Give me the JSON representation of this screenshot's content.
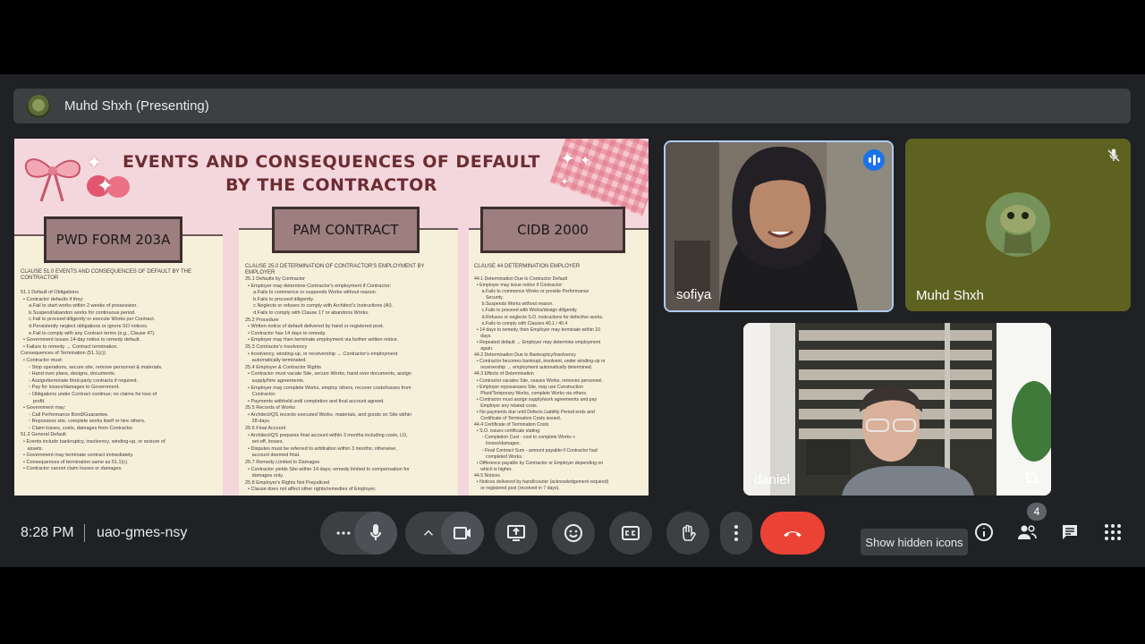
{
  "presenter_bar": {
    "label": "Muhd Shxh (Presenting)"
  },
  "slide": {
    "title_line1": "EVENTS AND CONSEQUENCES OF DEFAULT",
    "title_line2": "BY THE CONTRACTOR",
    "columns": [
      {
        "heading": "PWD FORM 203A",
        "subtitle": "CLAUSE 51.0 EVENTS AND CONSEQUENCES OF DEFAULT BY THE CONTRACTOR",
        "lines": [
          "51.1 Default of Obligations",
          "  • Contractor defaults if they:",
          "      a.Fail to start works within 2 weeks of possession.",
          "      b.Suspend/abandon works for continuous period.",
          "      c.Fail to proceed diligently or execute Works per Contract.",
          "      d.Persistently neglect obligations or ignore SO notices.",
          "      e.Fail to comply with any Contract terms (e.g., Clause 47).",
          "  • Government issues 14-day notice to remedy default.",
          "  • Failure to remedy → Contract termination.",
          "Consequences of Termination (51.1(c))",
          "  • Contractor must:",
          "      ◦ Stop operations, secure site, remove personnel & materials.",
          "      ◦ Hand over plans, designs, documents.",
          "      ◦ Assign/terminate third-party contracts if required.",
          "      ◦ Pay for losses/damages to Government.",
          "      ◦ Obligations under Contract continue; no claims for loss of",
          "         profit.",
          "  • Government may:",
          "      ◦ Call Performance Bond/Guarantee.",
          "      ◦ Repossess site, complete works itself or hire others.",
          "      ◦ Claim losses, costs, damages from Contractor.",
          "51.2 General Default",
          "  • Events include bankruptcy, insolvency, winding-up, or seizure of",
          "     assets.",
          "  • Government may terminate contract immediately.",
          "  • Consequences of termination same as 51.1(c).",
          "  • Contractor cannot claim losses or damages."
        ]
      },
      {
        "heading": "PAM CONTRACT",
        "subtitle": "CLAUSE 25.0 DETERMINATION OF CONTRACTOR'S EMPLOYMENT BY EMPLOYER",
        "lines": [
          "25.1 Defaults by Contractor",
          "  • Employer may determine Contractor's employment if Contractor:",
          "      a.Fails to commence or suspends Works without reason.",
          "      b.Fails to proceed diligently.",
          "      c.Neglects or refuses to comply with Architect's Instructions (AI).",
          "      d.Fails to comply with Clause 17 or abandons Works.",
          "25.2 Procedure",
          "  • Written notice of default delivered by hand or registered post.",
          "  • Contractor has 14 days to remedy.",
          "  • Employer may then terminate employment via further written notice.",
          "25.3 Contractor's Insolvency",
          "  • Insolvency, winding-up, or receivership → Contractor's employment",
          "     automatically terminated.",
          "25.4 Employer & Contractor Rights",
          "  • Contractor must vacate Site, secure Works, hand over documents, assign",
          "     supply/hire agreements.",
          "  • Employer may complete Works, employ others, recover costs/losses from",
          "     Contractor.",
          "  • Payments withheld until completion and final account agreed.",
          "25.5 Records of Works",
          "  • Architect/QS records executed Works, materials, and goods on Site within",
          "     28 days.",
          "25.6 Final Account",
          "  • Architect/QS prepares final account within 3 months including costs, LD,",
          "     set-off, losses.",
          "  • Disputes must be referred to arbitration within 3 months; otherwise,",
          "     account deemed final.",
          "25.7 Remedy Limited to Damages",
          "  • Contractor yields Site within 14 days; remedy limited to compensation for",
          "     damages only.",
          "25.8 Employer's Rights Not Prejudiced",
          "  • Clause does not affect other rights/remedies of Employer."
        ]
      },
      {
        "heading": "CIDB 2000",
        "subtitle": "CLAUSE 44 DETERMINATION EMPLOYER",
        "lines": [
          "44.1 Determination Due to Contractor Default",
          "  • Employer may issue notice if Contractor:",
          "      a.Fails to commence Works or provide Performance",
          "         Security.",
          "      b.Suspends Works without reason.",
          "      c.Fails to proceed with Works/design diligently.",
          "      d.Refuses or neglects S.O. instructions for defective works.",
          "      e.Fails to comply with Clauses 40.1 / 40.4",
          "  • 14 days to remedy, then Employer may terminate within 10",
          "     days.",
          "  • Repeated default → Employer may determine employment",
          "     again.",
          "44.2 Determination Due to Bankruptcy/Insolvency",
          "  • Contractor becomes bankrupt, insolvent, under winding-up or",
          "     receivership → employment automatically determined.",
          "44.3 Effects of Determination",
          "  • Contractor vacates Site, ceases Works, removes personnel.",
          "  • Employer repossesses Site, may use Construction",
          "     Plant/Temporary Works, complete Works via others.",
          "  • Contractor must assign supply/work agreements and pay",
          "     Employer any related costs.",
          "  • No payments due until Defects Liability Period ends and",
          "     Certificate of Termination Costs issued.",
          "44.4 Certificate of Termination Costs",
          "  • S.O. issues certificate stating:",
          "      ◦ Completion Cost - cost to complete Works +",
          "         losses/damages.",
          "      ◦ Final Contract Sum - amount payable if Contractor had",
          "         completed Works.",
          "  • Difference payable by Contractor or Employer depending on",
          "     which is higher.",
          "44.5 Notices",
          "  • Notices delivered by hand/courier (acknowledgement required)",
          "     or registered post (received in 7 days)."
        ]
      }
    ]
  },
  "participants": [
    {
      "name": "sofiya",
      "speaking": true
    },
    {
      "name": "Muhd Shxh",
      "muted": true
    },
    {
      "name": "daniel"
    }
  ],
  "meeting": {
    "time": "8:28 PM",
    "code": "uao-gmes-nsy"
  },
  "controls": {
    "tooltip": "Show hidden icons",
    "people_count": "4"
  },
  "colors": {
    "background": "#202124",
    "end_call": "#ea4335",
    "speaking": "#1a73e8",
    "control": "#3c4043"
  }
}
